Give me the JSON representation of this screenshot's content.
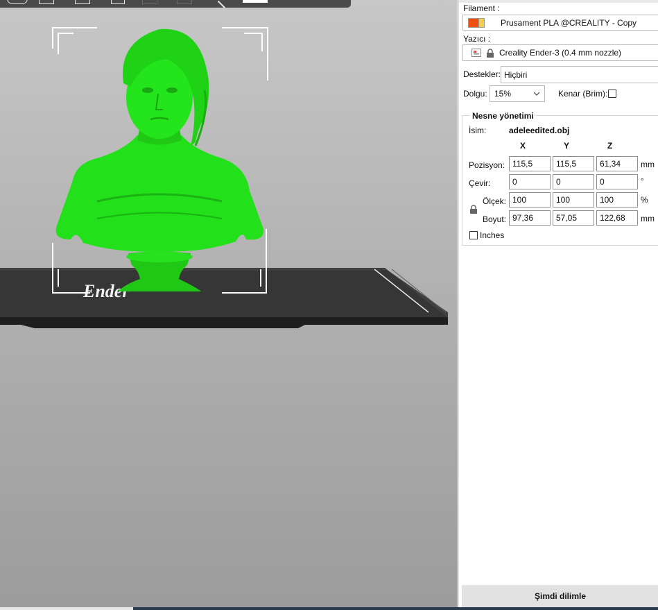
{
  "viewport": {
    "model_color": "#22e01a",
    "bed_color": "#2e2e2e"
  },
  "panel": {
    "filament": {
      "label": "Filament :",
      "value": "Prusament PLA @CREALITY - Copy",
      "swatch_colors": [
        "#f0500e",
        "#f5cf4a"
      ]
    },
    "printer": {
      "label": "Yazıcı :",
      "value": "Creality Ender-3 (0.4 mm nozzle)",
      "icons": [
        "printer-icon",
        "lock-icon"
      ]
    },
    "supports": {
      "label": "Destekler:",
      "value": "Hiçbiri"
    },
    "infill": {
      "label": "Dolgu:",
      "value": "15%"
    },
    "brim": {
      "label": "Kenar (Brim):",
      "checked": false
    },
    "object_manipulation": {
      "title": "Nesne yönetimi",
      "name_label": "İsim:",
      "name_value": "adeleedited.obj",
      "axes": [
        "X",
        "Y",
        "Z"
      ],
      "rows": [
        {
          "label": "Pozisyon:",
          "values": [
            "115,5",
            "115,5",
            "61,34"
          ],
          "unit": "mm"
        },
        {
          "label": "Çevir:",
          "values": [
            "0",
            "0",
            "0"
          ],
          "unit": "°"
        },
        {
          "label": "Ölçek:",
          "values": [
            "100",
            "100",
            "100"
          ],
          "unit": "%"
        },
        {
          "label": "Boyut:",
          "values": [
            "97,36",
            "57,05",
            "122,68"
          ],
          "unit": "mm"
        }
      ],
      "inches_label": "Inches",
      "inches_checked": false
    },
    "slice_button": "Şimdi dilimle"
  }
}
